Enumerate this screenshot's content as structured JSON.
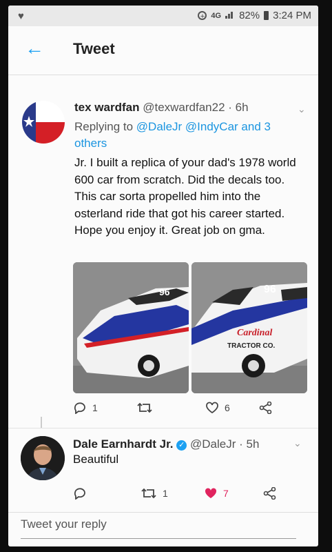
{
  "status": {
    "signal": "4G",
    "battery": "82%",
    "time": "3:24 PM"
  },
  "header": {
    "title": "Tweet"
  },
  "tweet": {
    "display_name": "tex wardfan",
    "handle": "@texwardfan22",
    "age": "· 6h",
    "replying_prefix": "Replying to",
    "replying_to": "@DaleJr @IndyCar and 3 others",
    "text": "Jr. I built a replica of your dad's 1978 world 600 car from scratch. Did the decals too. This car sorta propelled him into the osterland ride that got his career started. Hope you enjoy it. Great job on gma.",
    "image_text": {
      "number": "96",
      "sponsor": "Cardinal",
      "sponsor_sub": "TRACTOR CO."
    },
    "replies": "1",
    "retweets": "",
    "likes": "6"
  },
  "reply": {
    "display_name": "Dale Earnhardt Jr.",
    "handle": "@DaleJr",
    "age": "· 5h",
    "text": "Beautiful",
    "replies": "",
    "retweets": "1",
    "likes": "7"
  },
  "composer": {
    "placeholder": "Tweet your reply"
  },
  "colors": {
    "accent": "#1da1f2",
    "like": "#e0245e"
  }
}
